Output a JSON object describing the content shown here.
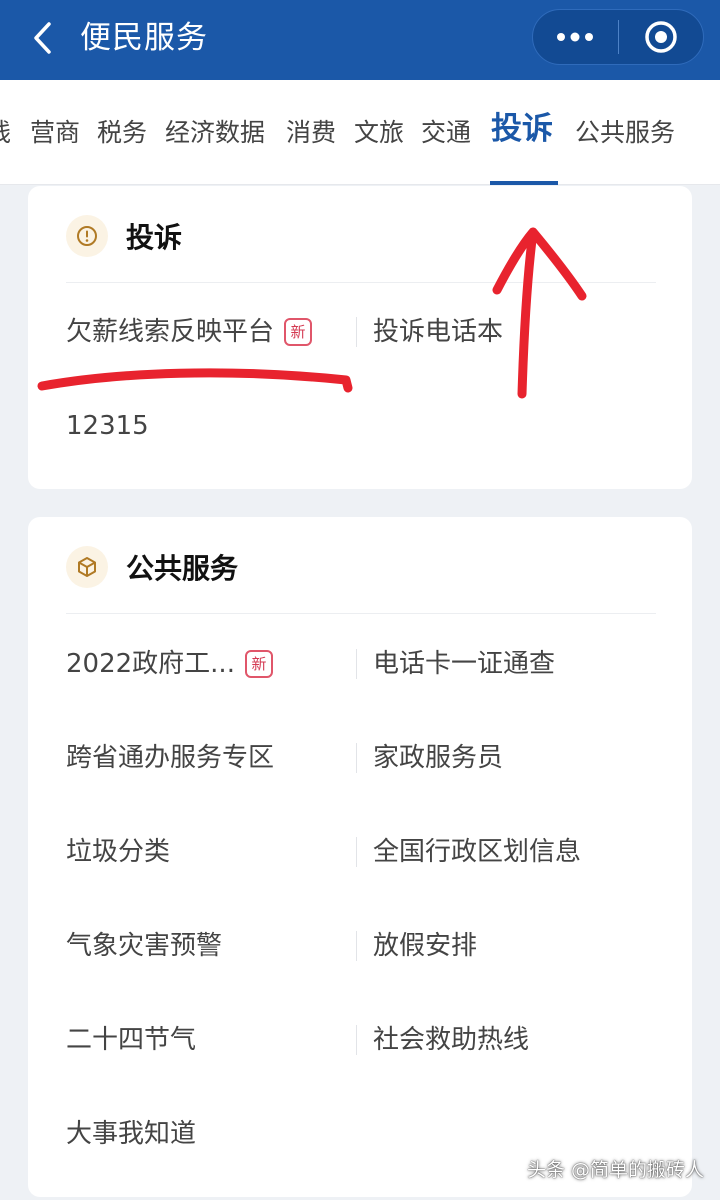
{
  "header": {
    "title": "便民服务",
    "back_icon": "chevron-left-icon",
    "more_icon": "more-dots-icon",
    "target_icon": "target-circle-icon",
    "color": "#1b58a8"
  },
  "tabs": [
    {
      "label": "线"
    },
    {
      "label": "营商"
    },
    {
      "label": "税务"
    },
    {
      "label": "经济数据"
    },
    {
      "label": "消费"
    },
    {
      "label": "文旅"
    },
    {
      "label": "交通"
    },
    {
      "label": "投诉",
      "active": true
    },
    {
      "label": "公共服务"
    }
  ],
  "complaint": {
    "title": "投诉",
    "icon": "alert-circle-icon",
    "items": [
      {
        "label": "欠薪线索反映平台",
        "badge": "新"
      },
      {
        "label": "投诉电话本"
      },
      {
        "label": "12315"
      }
    ]
  },
  "public": {
    "title": "公共服务",
    "icon": "cube-icon",
    "items": [
      {
        "label": "2022政府工...",
        "badge": "新"
      },
      {
        "label": "电话卡一证通查"
      },
      {
        "label": "跨省通办服务专区"
      },
      {
        "label": "家政服务员"
      },
      {
        "label": "垃圾分类"
      },
      {
        "label": "全国行政区划信息"
      },
      {
        "label": "气象灾害预警"
      },
      {
        "label": "放假安排"
      },
      {
        "label": "二十四节气"
      },
      {
        "label": "社会救助热线"
      },
      {
        "label": "大事我知道"
      }
    ]
  },
  "watermark": "头条 @简单的搬砖人",
  "colors": {
    "accent": "#1b58a8",
    "badge": "#d43a52",
    "annotation": "#e8232e"
  }
}
